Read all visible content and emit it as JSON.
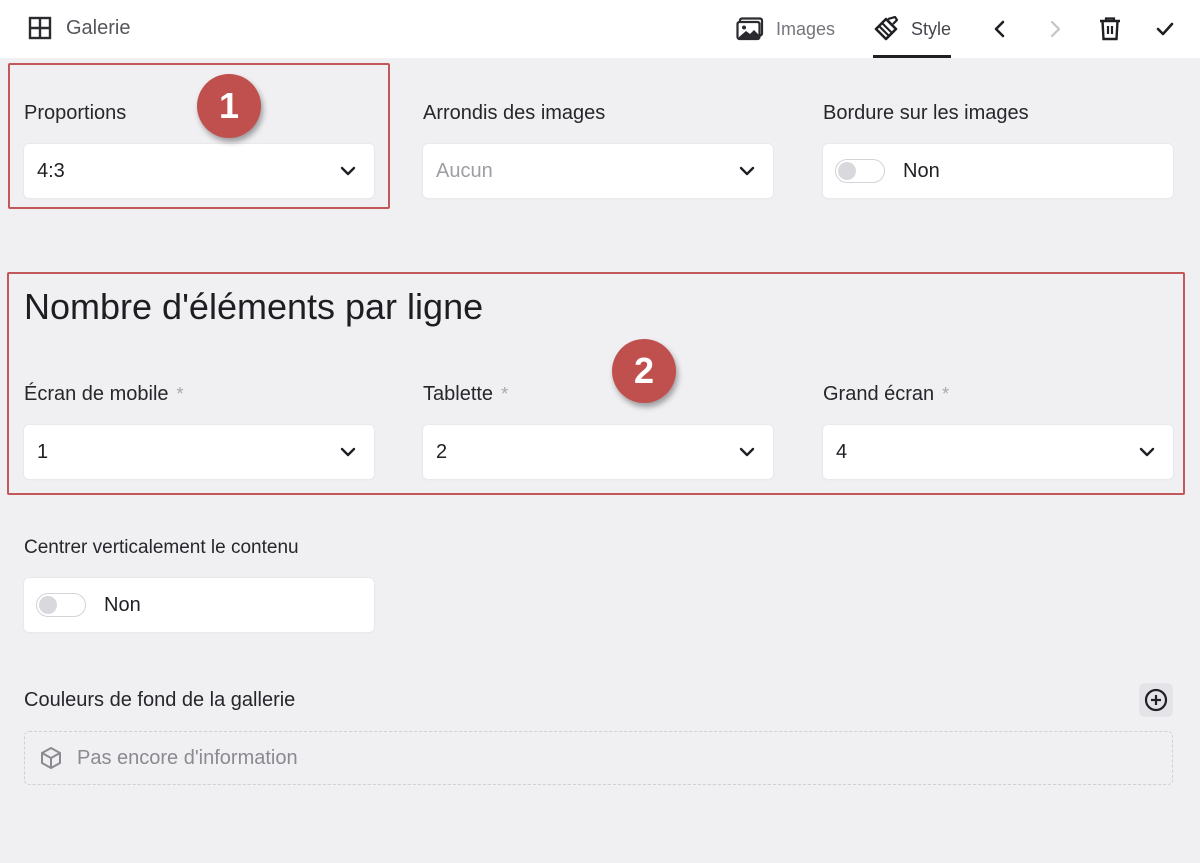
{
  "header": {
    "title": "Galerie",
    "tabs": [
      {
        "label": "Images",
        "icon": "image-icon",
        "active": false
      },
      {
        "label": "Style",
        "icon": "style-brush-icon",
        "active": true
      }
    ],
    "actions": [
      "chevron-left-icon",
      "chevron-right-icon",
      "trash-icon",
      "check-icon"
    ]
  },
  "annotations": {
    "one": "1",
    "two": "2",
    "color": "#c0504d"
  },
  "fields": {
    "proportions": {
      "label": "Proportions",
      "value": "4:3"
    },
    "rounding": {
      "label": "Arrondis des images",
      "placeholder": "Aucun"
    },
    "border": {
      "label": "Bordure sur les images",
      "state": "Non"
    }
  },
  "per_row": {
    "heading": "Nombre d'éléments par ligne",
    "mobile": {
      "label": "Écran de mobile",
      "required": "*",
      "value": "1"
    },
    "tablet": {
      "label": "Tablette",
      "required": "*",
      "value": "2"
    },
    "desktop": {
      "label": "Grand écran",
      "required": "*",
      "value": "4"
    }
  },
  "center": {
    "label": "Centrer verticalement le contenu",
    "state": "Non"
  },
  "bg_colors": {
    "label": "Couleurs de fond de la gallerie",
    "empty": "Pas encore d'information"
  }
}
